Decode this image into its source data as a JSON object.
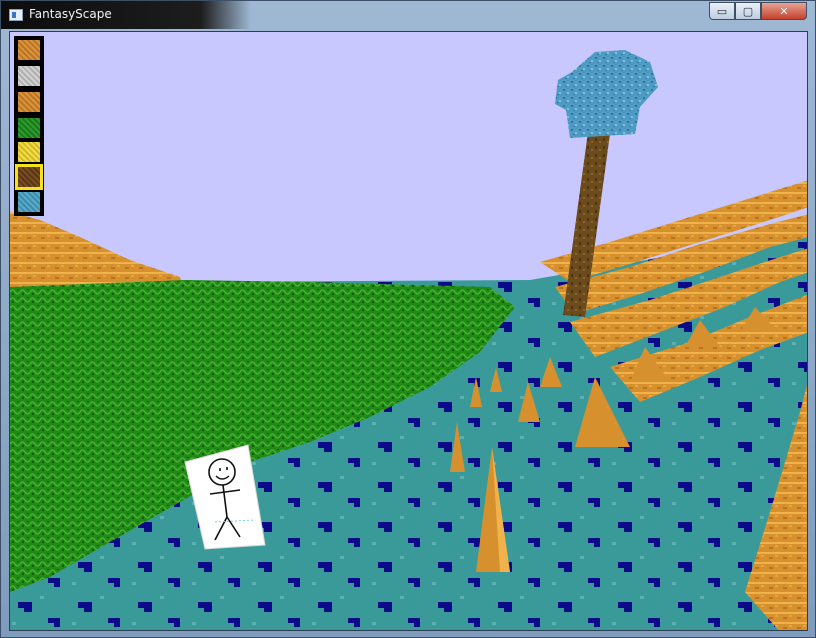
{
  "window": {
    "title": "FantasyScape",
    "controls": {
      "minimize": "▭",
      "maximize": "▢",
      "close": "✕"
    }
  },
  "hotbar": {
    "selected_index": 5,
    "slots": [
      {
        "block": "sand",
        "color": "#d88b2b"
      },
      {
        "block": "stone",
        "color": "#cfcfcf"
      },
      {
        "block": "sand",
        "color": "#d88b2b"
      },
      {
        "block": "leaves",
        "color": "#1d8f1d"
      },
      {
        "block": "gold",
        "color": "#f2da32"
      },
      {
        "block": "wood",
        "color": "#6b3f14"
      },
      {
        "block": "water",
        "color": "#4aa3c7"
      }
    ]
  },
  "scene": {
    "sky_color": "#c8c8ff",
    "grass_color": "#1f8a14",
    "water_color": "#3a9a9a",
    "sand_color": "#d6902e",
    "trunk_color": "#6b4a1c",
    "canopy_color": "#4f9bc4",
    "dark_patch_color": "#0b0b8a"
  },
  "sign": {
    "drawing": "stick-figure"
  }
}
